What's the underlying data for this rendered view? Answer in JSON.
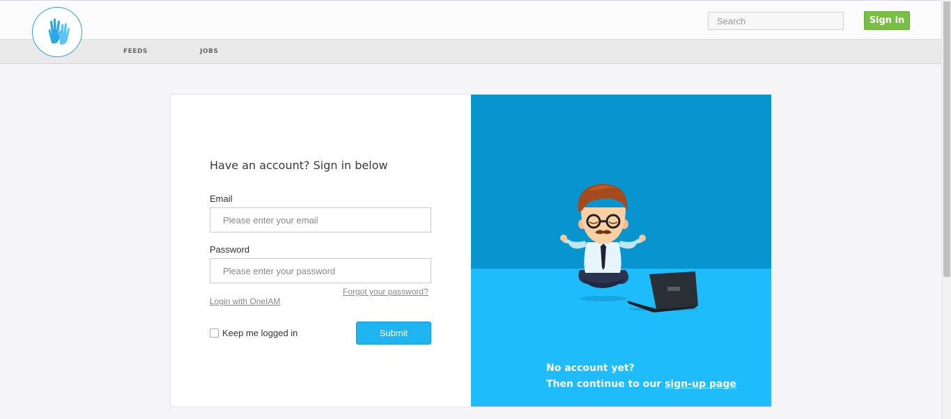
{
  "header": {
    "logo_icon": "high-five-hands-icon",
    "search": {
      "placeholder": "Search",
      "value": ""
    },
    "signin_label": "Sign in",
    "colors": {
      "signin": "#78c043",
      "logo_ring": "#2aa3e0"
    }
  },
  "nav": {
    "items": [
      {
        "label": "FEEDS"
      },
      {
        "label": "JOBS"
      }
    ]
  },
  "login": {
    "title": "Have an account? Sign in below",
    "email": {
      "label": "Email",
      "placeholder": "Please enter your email",
      "value": ""
    },
    "password": {
      "label": "Password",
      "placeholder": "Please enter your password",
      "value": ""
    },
    "forgot_link": "Forgot your password?",
    "oneiam_link": "Login with OneIAM",
    "keep_logged_in": {
      "label": "Keep me logged in",
      "checked": false
    },
    "submit_label": "Submit",
    "colors": {
      "submit": "#1fb5f3"
    }
  },
  "promo": {
    "illustration": "meditating-man-with-laptop",
    "line1": "No account yet?",
    "line2_prefix": "Then continue to our ",
    "signup_link": "sign-up page",
    "colors": {
      "top": "#0895cf",
      "bottom": "#1fbcfc"
    }
  }
}
